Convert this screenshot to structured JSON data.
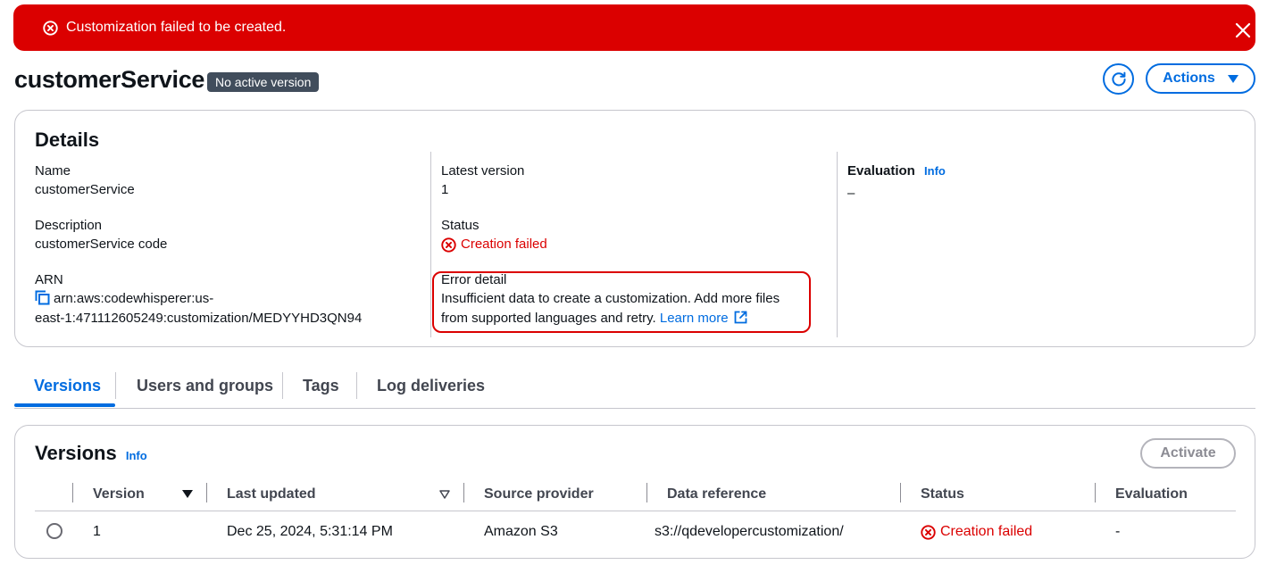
{
  "flash": {
    "message": "Customization failed to be created.",
    "icon": "error-circle-icon",
    "close_icon": "close-icon",
    "color": "#db0000"
  },
  "header": {
    "title": "customerService",
    "badge": "No active version",
    "refresh_icon": "refresh-icon",
    "actions_label": "Actions"
  },
  "details": {
    "heading": "Details",
    "name_label": "Name",
    "name_value": "customerService",
    "description_label": "Description",
    "description_value": "customerService code",
    "arn_label": "ARN",
    "arn_value_line1": "arn:aws:codewhisperer:us-",
    "arn_value_line2": "east-1:471112605249:customization/MEDYYHD3QN94",
    "latest_version_label": "Latest version",
    "latest_version_value": "1",
    "status_label": "Status",
    "status_value": "Creation failed",
    "error_detail_label": "Error detail",
    "error_detail_line1": "Insufficient data to create a customization. Add more files",
    "error_detail_line2": "from supported languages and retry.",
    "learn_more": "Learn more",
    "evaluation_label": "Evaluation",
    "evaluation_info": "Info",
    "evaluation_value": "–"
  },
  "tabs": [
    {
      "label": "Versions",
      "active": true
    },
    {
      "label": "Users and groups",
      "active": false
    },
    {
      "label": "Tags",
      "active": false
    },
    {
      "label": "Log deliveries",
      "active": false
    }
  ],
  "versions": {
    "heading": "Versions",
    "info": "Info",
    "activate_label": "Activate",
    "columns": [
      "Version",
      "Last updated",
      "Source provider",
      "Data reference",
      "Status",
      "Evaluation"
    ],
    "rows": [
      {
        "version": "1",
        "last_updated": "Dec 25, 2024, 5:31:14 PM",
        "source_provider": "Amazon S3",
        "data_reference": "s3://qdevelopercustomization/",
        "status": "Creation failed",
        "evaluation": "-"
      }
    ]
  },
  "colors": {
    "accent": "#006ce0",
    "error": "#db0000",
    "badge_bg": "#414d5c",
    "border": "#c6c6cd"
  }
}
